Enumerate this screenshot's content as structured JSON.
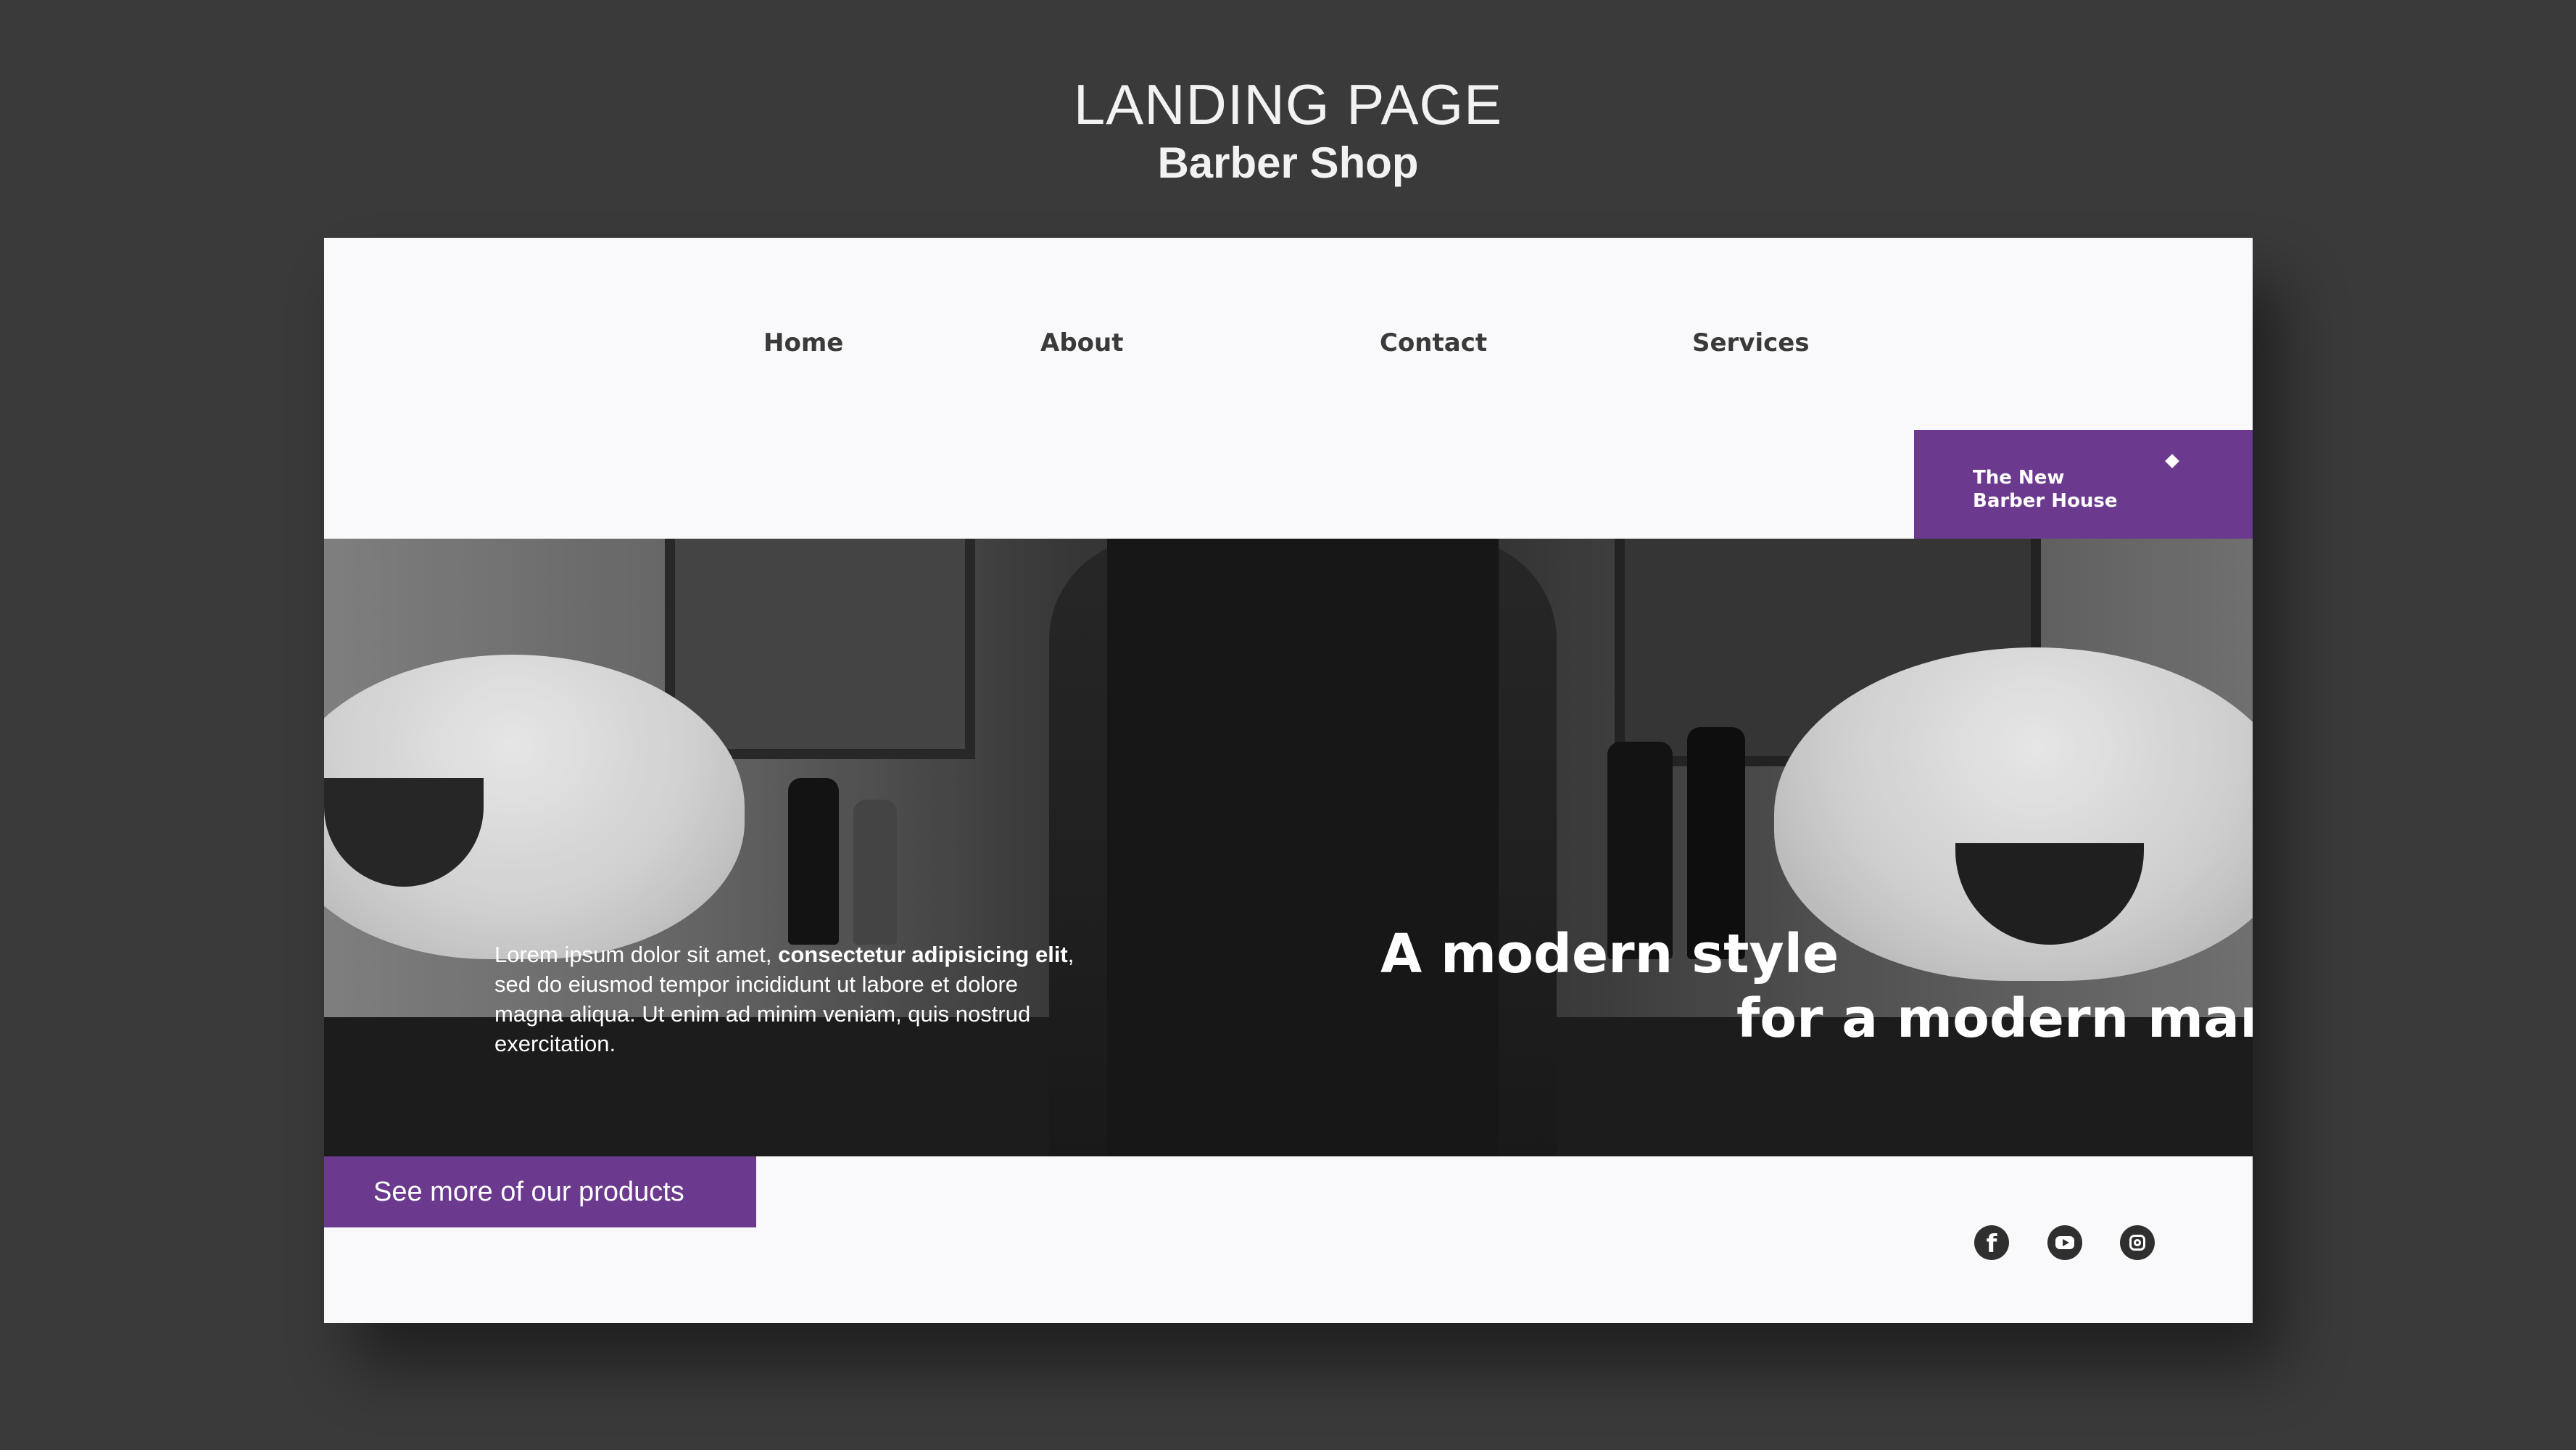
{
  "mockup": {
    "title": "LANDING PAGE",
    "subtitle": "Barber Shop"
  },
  "nav": {
    "items": [
      {
        "label": "Home"
      },
      {
        "label": "About"
      },
      {
        "label": "Contact"
      },
      {
        "label": "Services"
      }
    ]
  },
  "badge": {
    "line1": "The New",
    "line2": "Barber House"
  },
  "hero": {
    "blurb_lead": "Lorem ipsum dolor sit amet, ",
    "blurb_bold": "consectetur adipisicing elit",
    "blurb_tail": ", sed do eiusmod tempor incididunt ut labore et dolore magna aliqua. Ut enim ad minim veniam, quis nostrud exercitation.",
    "headline_line1": "A modern style",
    "headline_line2": "for a modern man"
  },
  "cta": {
    "label": "See more of our products"
  },
  "social": {
    "facebook_glyph": "f"
  },
  "colors": {
    "background": "#3a3a3a",
    "card": "#f9f8fb",
    "accent": "#6b3a8e",
    "nav_text": "#3a3a3a",
    "icon_fill": "#2f2f2f"
  },
  "icons": [
    "diamond-icon",
    "facebook-icon",
    "youtube-icon",
    "instagram-icon"
  ]
}
